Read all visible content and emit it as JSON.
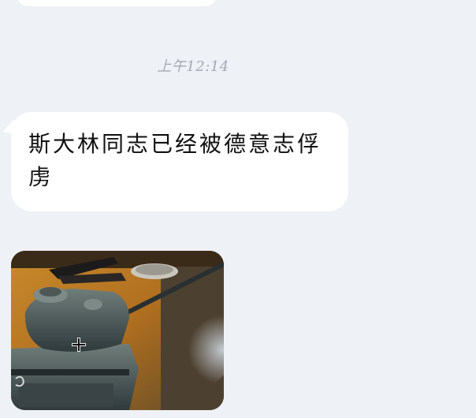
{
  "chat": {
    "timestamp": "上午12:14",
    "messages": [
      {
        "type": "text",
        "text": "斯大林同志已经被德意志俘虏"
      },
      {
        "type": "image",
        "image_subject": "tank-model-photo"
      }
    ]
  },
  "colors": {
    "background": "#eef1f6",
    "bubble": "#ffffff",
    "timestamp": "#a4a9b3",
    "text": "#111111"
  }
}
